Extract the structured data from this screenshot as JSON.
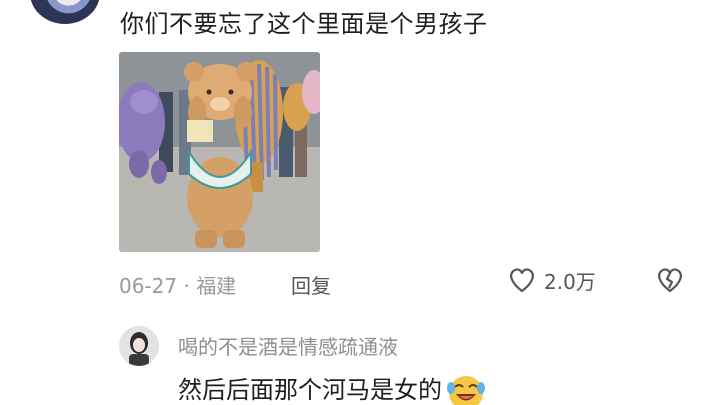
{
  "comment": {
    "text": "你们不要忘了这个里面是个男孩子",
    "date_location": "06-27 · 福建",
    "reply_label": "回复",
    "like_count": "2.0万",
    "image_icon": "photo-bear-mascot"
  },
  "reply": {
    "username": "喝的不是酒是情感疏通液",
    "text": "然后后面那个河马是女的",
    "emoji": "laughing-crying-emoji"
  },
  "icons": {
    "like": "heart-outline-icon",
    "dislike": "broken-heart-icon"
  }
}
